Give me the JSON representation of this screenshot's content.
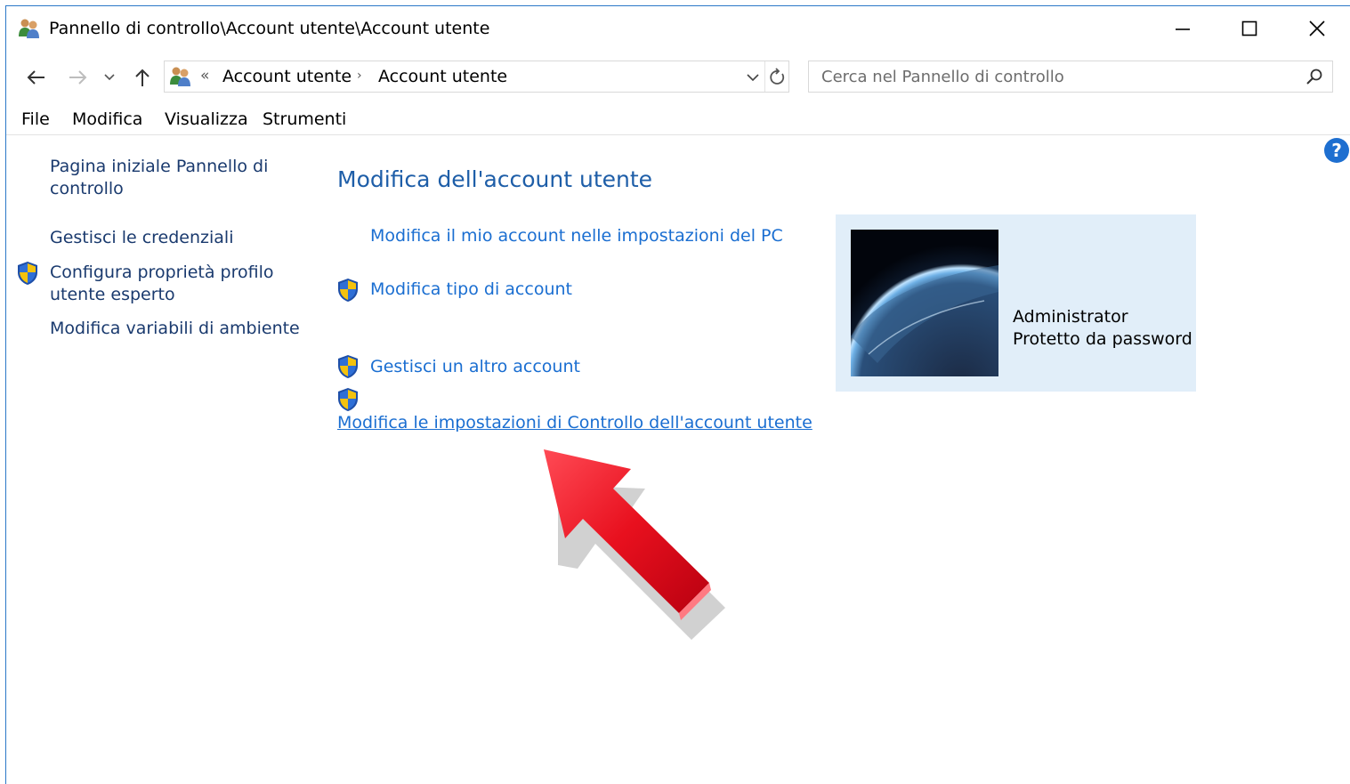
{
  "window": {
    "title": "Pannello di controllo\\Account utente\\Account utente"
  },
  "navigation": {
    "back": "back-arrow",
    "forward": "forward-arrow",
    "recent": "chevron-down",
    "up": "up-arrow",
    "address": {
      "overflow": "«",
      "crumbs": [
        "Account utente",
        "Account utente"
      ]
    },
    "search": {
      "placeholder": "Cerca nel Pannello di controllo"
    }
  },
  "menu": [
    "File",
    "Modifica",
    "Visualizza",
    "Strumenti"
  ],
  "left_pane": {
    "home_line1": "Pagina iniziale Pannello di",
    "home_line2": "controllo",
    "credentials": "Gestisci le credenziali",
    "profile_line1": "Configura proprietà profilo",
    "profile_line2": "utente esperto",
    "env_vars": "Modifica variabili di ambiente"
  },
  "main": {
    "heading": "Modifica dell'account utente",
    "tasks": {
      "pc_settings": "Modifica il mio account nelle impostazioni del PC",
      "account_type": "Modifica tipo di account",
      "other_account": "Gestisci un altro account",
      "uac_settings": "Modifica le impostazioni di Controllo dell'account utente"
    }
  },
  "account": {
    "name": "Administrator",
    "status": "Protetto da password"
  },
  "colors": {
    "link": "#1a6ed1",
    "heading": "#1e5ea8",
    "card_bg": "#e1eef9",
    "arrow": "#e8101e"
  }
}
